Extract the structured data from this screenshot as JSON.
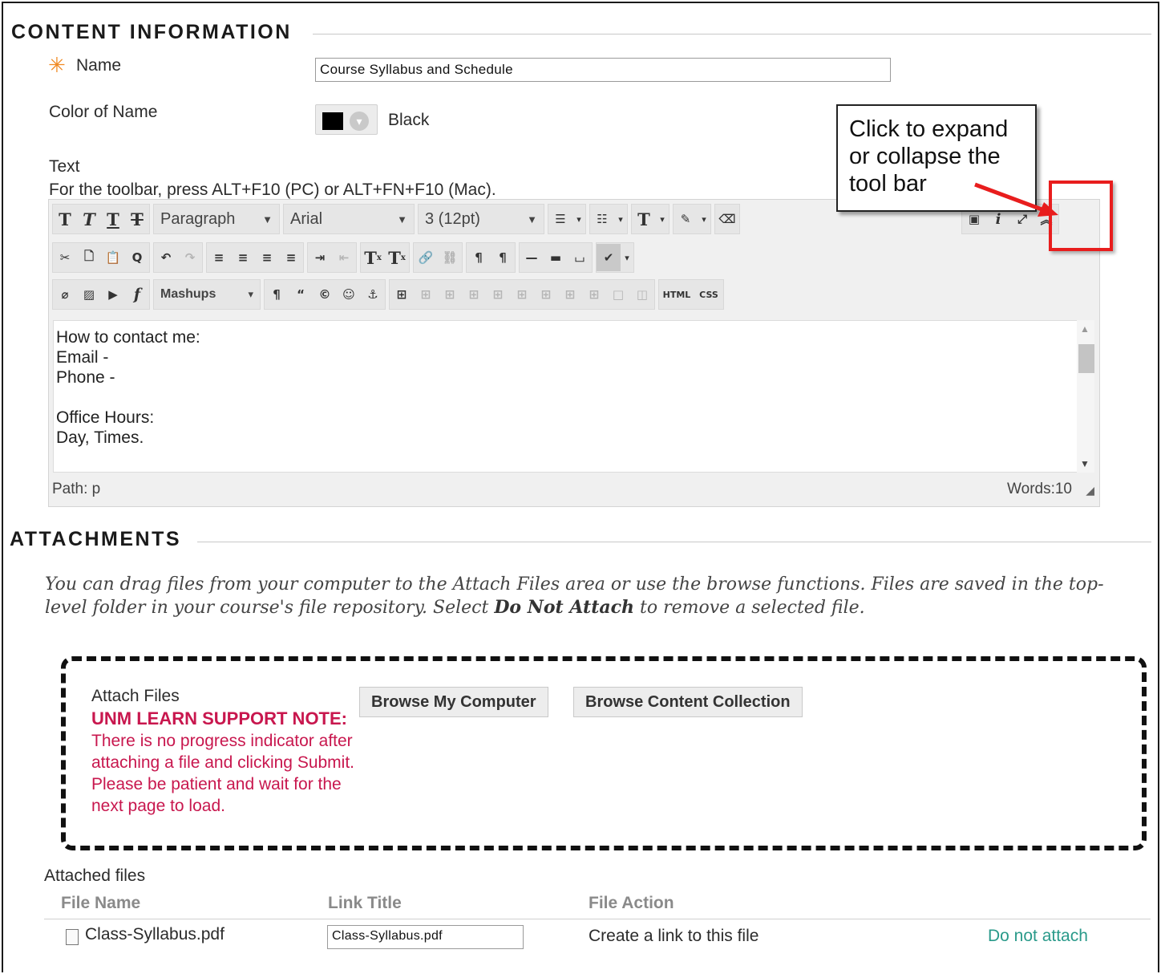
{
  "content_info": {
    "section_title": "CONTENT INFORMATION",
    "required_marker": "✳",
    "name_label": "Name",
    "name_value": "Course Syllabus and Schedule",
    "color_label": "Color of Name",
    "color_value": "Black",
    "color_hex": "#000000",
    "text_label": "Text",
    "toolbar_hint": "For the toolbar, press ALT+F10 (PC) or ALT+FN+F10 (Mac)."
  },
  "editor": {
    "paragraph_select": "Paragraph",
    "font_select": "Arial",
    "size_select": "3 (12pt)",
    "mashups_label": "Mashups",
    "html_label": "HTML",
    "css_label": "CSS",
    "body_lines": [
      "How to contact me:",
      "Email -",
      "Phone -",
      "",
      "Office Hours:",
      "Day, Times."
    ],
    "path_label": "Path: p",
    "words_label": "Words:10"
  },
  "callout": {
    "text": "Click to expand or collapse the tool bar",
    "box_color": "#e81d1d"
  },
  "attachments": {
    "section_title": "ATTACHMENTS",
    "desc_1": "You can drag files from your computer to the Attach Files area or use the browse functions. Files are saved in the top-level folder in your course's file repository.  Select ",
    "desc_bold": "Do Not Attach",
    "desc_2": "  to remove a selected file.",
    "attach_label": "Attach Files",
    "note_title": "UNM LEARN SUPPORT NOTE:",
    "note_text": "There is no progress indicator after attaching a file and clicking Submit. Please be patient and wait for the next page to load.",
    "browse_computer": "Browse My Computer",
    "browse_collection": "Browse Content Collection",
    "attached_files_label": "Attached files",
    "columns": [
      "File Name",
      "Link Title",
      "File Action"
    ],
    "files": [
      {
        "name": "Class-Syllabus.pdf",
        "link_title": "Class-Syllabus.pdf",
        "action": "Create a link to this file",
        "remove": "Do not attach"
      }
    ],
    "note_color": "#c8174e",
    "link_color": "#2a9a8a"
  }
}
